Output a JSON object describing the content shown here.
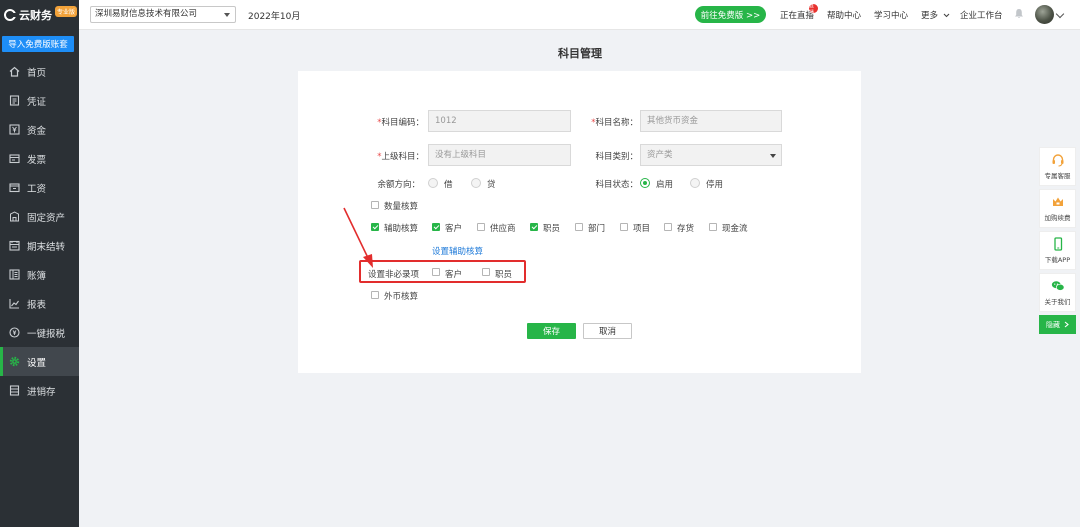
{
  "brand": {
    "logo_text": "云财务",
    "badge": "专业版"
  },
  "sidebar": {
    "import_button": "导入免费版账套",
    "items": [
      {
        "label": "首页",
        "icon": "home-icon"
      },
      {
        "label": "凭证",
        "icon": "voucher-icon"
      },
      {
        "label": "资金",
        "icon": "funds-icon"
      },
      {
        "label": "发票",
        "icon": "invoice-icon"
      },
      {
        "label": "工资",
        "icon": "salary-icon"
      },
      {
        "label": "固定资产",
        "icon": "assets-icon"
      },
      {
        "label": "期末结转",
        "icon": "period-close-icon"
      },
      {
        "label": "账簿",
        "icon": "ledger-icon"
      },
      {
        "label": "报表",
        "icon": "report-icon"
      },
      {
        "label": "一键报税",
        "icon": "tax-icon"
      },
      {
        "label": "设置",
        "icon": "gear-icon",
        "active": true
      },
      {
        "label": "进销存",
        "icon": "inventory-icon"
      }
    ]
  },
  "header": {
    "company": "深圳易财信息技术有限公司",
    "period": "2022年10月",
    "go_free_button": "前往免费版 >>",
    "live": "正在直播",
    "live_badge": "直播",
    "help": "帮助中心",
    "learn": "学习中心",
    "more": "更多",
    "workspace": "企业工作台"
  },
  "page": {
    "title": "科目管理"
  },
  "form": {
    "code": {
      "label": "科目编码：",
      "value": "1012"
    },
    "name": {
      "label": "科目名称：",
      "value": "其他货币资金"
    },
    "parent": {
      "label": "上级科目：",
      "placeholder": "没有上级科目"
    },
    "category": {
      "label": "科目类别：",
      "value": "资产类"
    },
    "balance": {
      "label": "余额方向：",
      "debit": "借",
      "credit": "贷"
    },
    "status": {
      "label": "科目状态：",
      "enabled": "启用",
      "disabled": "停用"
    },
    "quantity": "数量核算",
    "auxiliary": {
      "label": "辅助核算",
      "options": [
        {
          "label": "客户",
          "checked": true
        },
        {
          "label": "供应商",
          "checked": false
        },
        {
          "label": "职员",
          "checked": true
        },
        {
          "label": "部门",
          "checked": false
        },
        {
          "label": "项目",
          "checked": false
        },
        {
          "label": "存货",
          "checked": false
        },
        {
          "label": "现金流",
          "checked": false
        }
      ]
    },
    "set_aux_link": "设置辅助核算",
    "non_required": {
      "label": "设置非必录项",
      "customer": "客户",
      "staff": "职员"
    },
    "foreign_currency": "外币核算",
    "save": "保存",
    "cancel": "取消"
  },
  "float_panel": {
    "service": "专属客服",
    "buy": "加购续费",
    "app": "下载APP",
    "about": "关于我们",
    "hide": "隐藏"
  },
  "colors": {
    "primary": "#27b548",
    "sidebar": "#2b3035",
    "link": "#1e7ad9",
    "highlight": "#e22d2d"
  }
}
